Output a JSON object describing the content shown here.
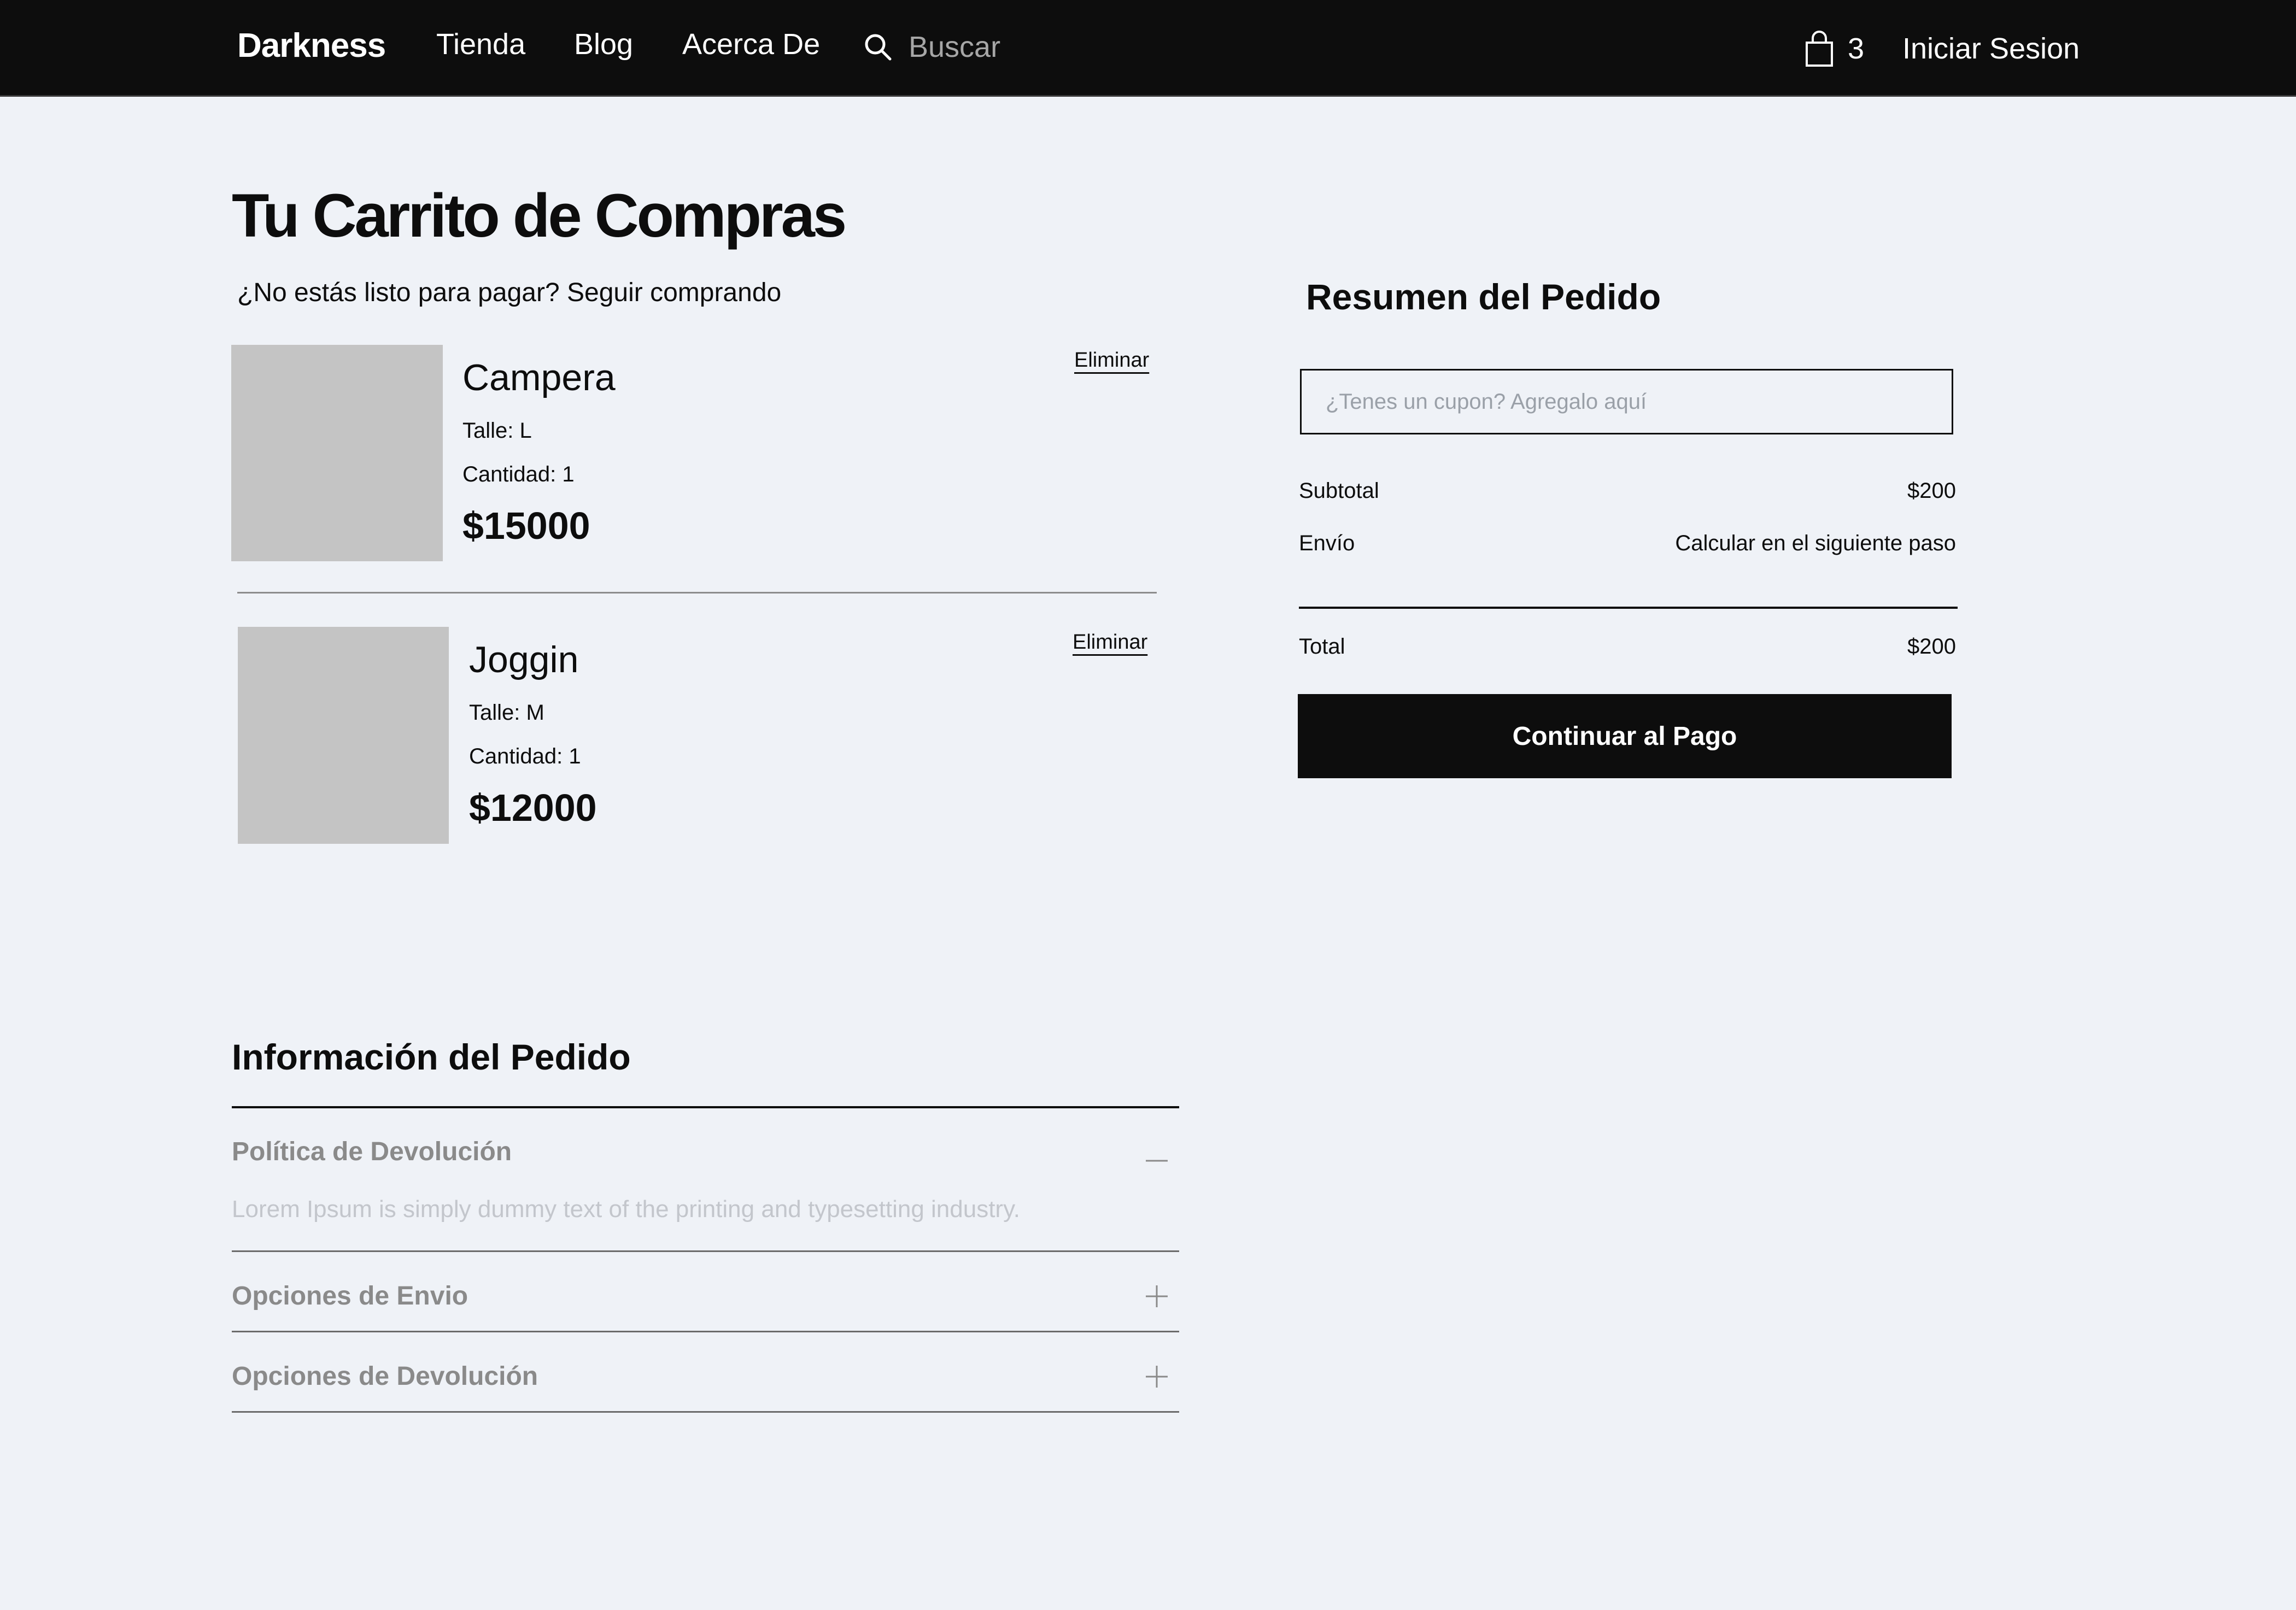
{
  "header": {
    "brand": "Darkness",
    "nav": [
      "Tienda",
      "Blog",
      "Acerca De"
    ],
    "search_placeholder": "Buscar",
    "cart_count": "3",
    "login_label": "Iniciar Sesion"
  },
  "cart": {
    "title": "Tu Carrito de Compras",
    "subtitle_text": "¿No estás listo para pagar? ",
    "subtitle_link": "Seguir comprando",
    "items": [
      {
        "name": "Campera",
        "size": "Talle: L",
        "quantity": "Cantidad: 1",
        "price": "$15000",
        "remove_label": "Eliminar"
      },
      {
        "name": "Joggin",
        "size": "Talle: M",
        "quantity": "Cantidad: 1",
        "price": "$12000",
        "remove_label": "Eliminar"
      }
    ]
  },
  "summary": {
    "title": "Resumen del Pedido",
    "coupon_placeholder": "¿Tenes un cupon? Agregalo aquí",
    "subtotal_label": "Subtotal",
    "subtotal_value": "$200",
    "shipping_label": "Envío",
    "shipping_value": "Calcular en el siguiente paso",
    "total_label": "Total",
    "total_value": "$200",
    "checkout_label": "Continuar al Pago"
  },
  "order_info": {
    "title": "Información del Pedido",
    "sections": [
      {
        "title": "Política de Devolución",
        "expanded": true,
        "body": "Lorem Ipsum is simply dummy text of the printing and typesetting industry."
      },
      {
        "title": "Opciones de Envio",
        "expanded": false
      },
      {
        "title": "Opciones de Devolución",
        "expanded": false
      }
    ]
  },
  "icons": {
    "search": "search-icon",
    "cart": "shopping-bag-icon",
    "collapse": "minus-icon",
    "expand": "plus-icon"
  },
  "colors": {
    "header_bg": "#0d0d0d",
    "page_bg": "#eff2f7",
    "placeholder_image": "#c4c4c4",
    "button_bg": "#0d0d0d"
  }
}
